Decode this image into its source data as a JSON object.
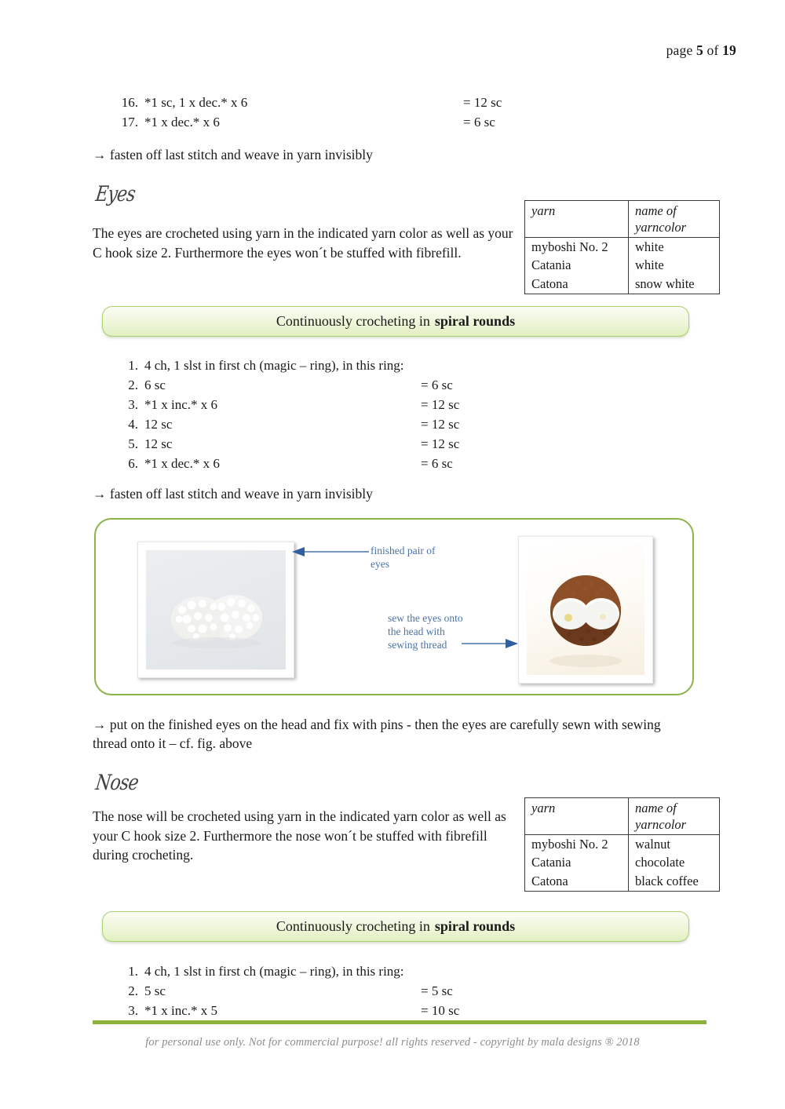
{
  "header": {
    "prefix": "page",
    "page_number": "5",
    "middle": "of",
    "total_pages": "19"
  },
  "head_rows": [
    {
      "num": "16.",
      "text": "*1 sc, 1 x dec.* x 6",
      "count": "= 12 sc"
    },
    {
      "num": "17.",
      "text": "*1 x dec.* x 6",
      "count": "= 6 sc"
    }
  ],
  "head_fasten_off": "→ fasten off  last stitch and weave in yarn invisibly",
  "eyes": {
    "heading": "Eyes",
    "body": "The eyes are crocheted using yarn in the indicated yarn color as well as your C hook size 2. Furthermore the eyes won´t be stuffed with fibrefill.",
    "table": {
      "header": {
        "col1": "yarn",
        "col2_line1": "name of",
        "col2_line2": "yarncolor"
      },
      "rows": [
        {
          "yarn": "myboshi No. 2",
          "color": "white"
        },
        {
          "yarn": "Catania",
          "color": "white"
        },
        {
          "yarn": "Catona",
          "color": "snow white"
        }
      ]
    },
    "banner": {
      "prefix": "Continuously crocheting in",
      "emphasis": "spiral rounds"
    },
    "rows": [
      {
        "num": "1.",
        "text": "4 ch, 1 slst in first ch (magic – ring), in this ring:",
        "count": ""
      },
      {
        "num": "2.",
        "text": "6 sc",
        "count": "= 6 sc"
      },
      {
        "num": "3.",
        "text": "*1 x inc.* x 6",
        "count": "= 12 sc"
      },
      {
        "num": "4.",
        "text": "12 sc",
        "count": "= 12 sc"
      },
      {
        "num": "5.",
        "text": "12 sc",
        "count": "= 12 sc"
      },
      {
        "num": "6.",
        "text": "*1 x dec.* x 6",
        "count": "= 6 sc"
      }
    ],
    "fasten_off": "→ fasten off  last stitch and weave in yarn invisibly",
    "figure": {
      "annotation_1_line1": "finished pair of",
      "annotation_1_line2": "eyes",
      "annotation_2_line1": "sew the eyes onto",
      "annotation_2_line2": "the head with",
      "annotation_2_line3": "sewing thread",
      "left_photo_alt": "photo of two finished white crocheted eyes",
      "right_photo_alt": "photo of brown crocheted owl head with white eyes pinned on"
    },
    "after_figure_text": "→ put on the finished eyes on the head and fix with pins - then the eyes are carefully sewn with sewing thread onto it – cf. fig. above"
  },
  "nose": {
    "heading": "Nose",
    "body": "The nose will be crocheted using yarn in the indicated yarn color as well as your C hook size 2. Furthermore the nose won´t be stuffed with fibrefill during crocheting.",
    "table": {
      "header": {
        "col1": "yarn",
        "col2_line1": "name of",
        "col2_line2": "yarncolor"
      },
      "rows": [
        {
          "yarn": "myboshi No. 2",
          "color": "walnut"
        },
        {
          "yarn": "Catania",
          "color": "chocolate"
        },
        {
          "yarn": "Catona",
          "color": "black coffee"
        }
      ]
    },
    "banner": {
      "prefix": "Continuously crocheting in",
      "emphasis": "spiral rounds"
    },
    "rows": [
      {
        "num": "1.",
        "text": "4 ch, 1 slst in first ch (magic – ring), in this ring:",
        "count": ""
      },
      {
        "num": "2.",
        "text": "5 sc",
        "count": "= 5 sc"
      },
      {
        "num": "3.",
        "text": "*1 x inc.* x 5",
        "count": "= 10 sc"
      }
    ]
  },
  "footer": {
    "text": "for personal use only. Not for commercial purpose! all rights reserved - copyright by mala designs ® 2018"
  },
  "colors": {
    "banner_border": "#a9cf70",
    "figure_border": "#8cb34a",
    "footer_rule": "#8cb23c",
    "annotation_blue": "#4a72a8"
  }
}
